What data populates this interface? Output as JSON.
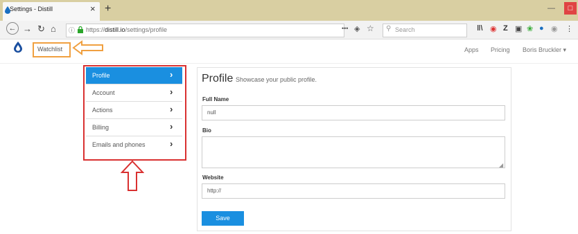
{
  "browser": {
    "tab_title": "Settings - Distill",
    "tab_close": "×",
    "new_tab": "+",
    "url_host": "https://distill.io",
    "url_path": "/settings/profile",
    "url_full_prefix": "https://",
    "url_bold": "distill.io",
    "url_rest": "/settings/profile",
    "more": "•••",
    "search_placeholder": "Search",
    "icons": [
      "library-icon",
      "pocket-icon",
      "zotero-icon",
      "screenshot-icon",
      "extension-icon",
      "distill-icon",
      "shield-icon",
      "menu-icon"
    ],
    "colors": {
      "tabstrip": "#d9cfa2",
      "close": "#e04343"
    }
  },
  "app": {
    "logo": "distill-drop-icon",
    "watchlist": "Watchlist",
    "nav": [
      "Apps",
      "Pricing",
      "Boris Bruckler ▾"
    ]
  },
  "sidebar": {
    "items": [
      {
        "label": "Profile",
        "active": true
      },
      {
        "label": "Account",
        "active": false
      },
      {
        "label": "Actions",
        "active": false
      },
      {
        "label": "Billing",
        "active": false
      },
      {
        "label": "Emails and phones",
        "active": false
      }
    ],
    "accent": "#1a8fe0",
    "highlight": "#d93030"
  },
  "profile": {
    "title": "Profile",
    "subtitle": "Showcase your public profile.",
    "full_name_label": "Full Name",
    "full_name_value": "null",
    "bio_label": "Bio",
    "bio_value": "",
    "website_label": "Website",
    "website_value": "http://",
    "save": "Save"
  }
}
